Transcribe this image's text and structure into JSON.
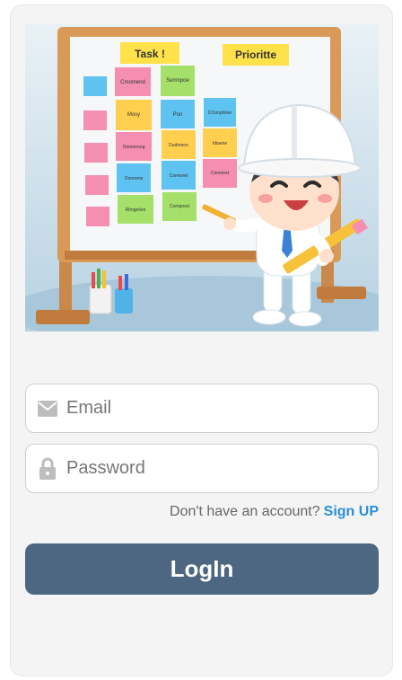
{
  "hero": {
    "board_titles": [
      "Task !",
      "Prioritte"
    ],
    "notes": [
      {
        "text": "Cmomend",
        "color": "#f48fb1"
      },
      {
        "text": "Semnpoe",
        "color": "#a5e06a"
      },
      {
        "text": "Mosy",
        "color": "#ffcf4d"
      },
      {
        "text": "Pon",
        "color": "#5ec3f0"
      },
      {
        "text": "Cčomplione",
        "color": "#5ec3f0"
      },
      {
        "text": "Oomneong",
        "color": "#f48fb1"
      },
      {
        "text": "Dudmeon",
        "color": "#ffcf4d"
      },
      {
        "text": "Idiaene",
        "color": "#ffcf4d"
      },
      {
        "text": "Ooreome",
        "color": "#5ec3f0"
      },
      {
        "text": "Coreoeet",
        "color": "#5ec3f0"
      },
      {
        "text": "Conmeet",
        "color": "#f48fb1"
      },
      {
        "text": "Rhngetion",
        "color": "#a5e06a"
      },
      {
        "text": "Compreot",
        "color": "#a5e06a"
      }
    ]
  },
  "form": {
    "email": {
      "placeholder": "Email",
      "value": "",
      "icon": "mail-icon"
    },
    "password": {
      "placeholder": "Password",
      "value": "",
      "icon": "lock-icon"
    }
  },
  "signup": {
    "prompt": "Don't have an account?",
    "link_label": "Sign UP",
    "link_color": "#2a8fd8"
  },
  "login_button": {
    "label": "LogIn",
    "color": "#4d6681"
  }
}
